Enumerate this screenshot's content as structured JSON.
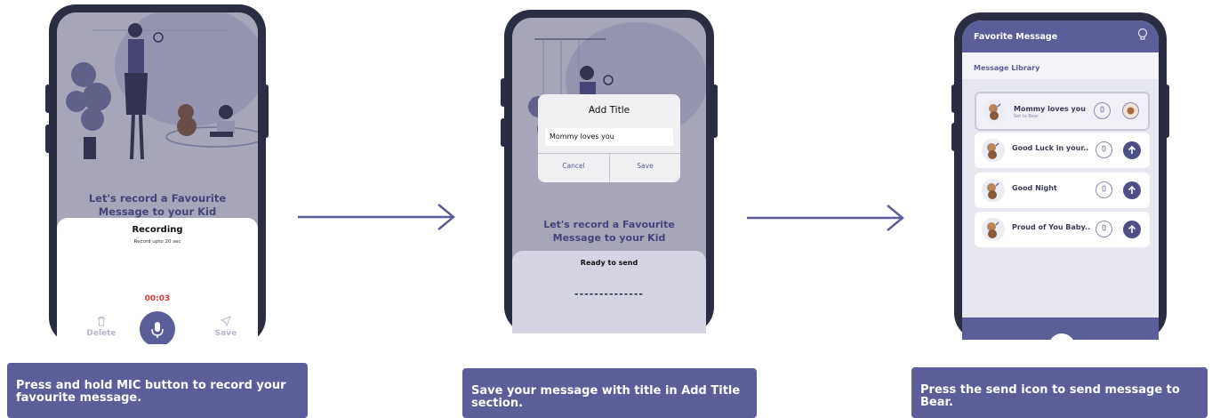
{
  "colors": {
    "accent": "#5c5e9a",
    "phone": "#2b2d42",
    "timer": "#e53935"
  },
  "screen1": {
    "headline": "Let's record a Favourite Message to your Kid",
    "sheet_title": "Recording",
    "sheet_subtitle": "Record upto 20 sec",
    "timer": "00:03",
    "delete_label": "Delete",
    "save_label": "Save",
    "icons": {
      "delete": "trash-icon",
      "mic": "mic-icon",
      "save": "send-icon"
    }
  },
  "screen2": {
    "dialog_title": "Add Title",
    "title_input_value": "Mommy loves you",
    "cancel_label": "Cancel",
    "save_label": "Save",
    "headline": "Let's record a Favourite Message to your Kid",
    "sheet_title": "Ready to send",
    "dashes": "--------------"
  },
  "screen3": {
    "header_title": "Favorite Message",
    "section_title": "Message Library",
    "messages": [
      {
        "title": "Mommy loves you",
        "subtitle": "Set to Bear",
        "selected": true,
        "action_icon": "bear-icon"
      },
      {
        "title": "Good Luck in your..",
        "subtitle": "",
        "selected": false,
        "action_icon": "upload-icon"
      },
      {
        "title": "Good Night",
        "subtitle": "",
        "selected": false,
        "action_icon": "upload-icon"
      },
      {
        "title": "Proud of You Baby..",
        "subtitle": "",
        "selected": false,
        "action_icon": "upload-icon"
      }
    ],
    "icons": {
      "header": "lightbulb-icon",
      "play": "play-icon",
      "mic": "mic-icon"
    }
  },
  "captions": [
    "Press and hold MIC button to record your favourite message.",
    "Save your message with title in Add Title section.",
    "Press the send icon to send message to Bear."
  ]
}
